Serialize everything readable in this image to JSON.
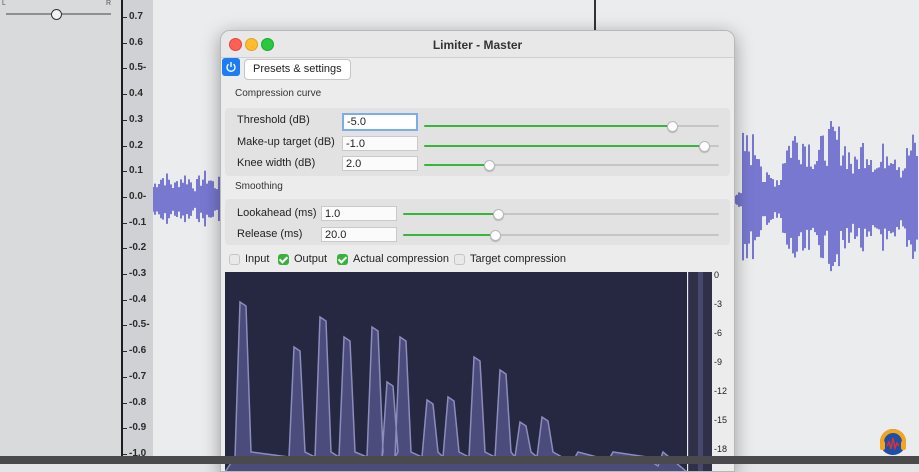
{
  "audacity": {
    "slider_left_label": "L",
    "slider_right_label": "R",
    "ruler_ticks": [
      "0.7",
      "0.6",
      "0.5-",
      "0.4",
      "0.3",
      "0.2",
      "0.1",
      "0.0-",
      "-0.1",
      "-0.2",
      "-0.3",
      "-0.4",
      "-0.5-",
      "-0.6",
      "-0.7",
      "-0.8",
      "-0.9",
      "-1.0"
    ],
    "waveform_color": "#5b5bc8"
  },
  "window": {
    "title": "Limiter - Master",
    "presets_label": "Presets & settings"
  },
  "compression_curve": {
    "title": "Compression curve",
    "params": [
      {
        "label": "Threshold (dB)",
        "value": "-5.0",
        "level": 0.84
      },
      {
        "label": "Make-up target (dB)",
        "value": "-1.0",
        "level": 0.95
      },
      {
        "label": "Knee width (dB)",
        "value": "2.0",
        "level": 0.22
      }
    ]
  },
  "smoothing": {
    "title": "Smoothing",
    "params": [
      {
        "label": "Lookahead (ms)",
        "value": "1.0",
        "level": 0.3
      },
      {
        "label": "Release (ms)",
        "value": "20.0",
        "level": 0.29
      }
    ]
  },
  "display_options": [
    {
      "label": "Input",
      "checked": false
    },
    {
      "label": "Output",
      "checked": true
    },
    {
      "label": "Actual compression",
      "checked": true
    },
    {
      "label": "Target compression",
      "checked": false
    }
  ],
  "db_scale": [
    "0",
    "-3",
    "-6",
    "-9",
    "-12",
    "-15",
    "-18"
  ],
  "colors": {
    "accent": "#38b63b",
    "power": "#1d7cf2",
    "graph_bg": "#262741",
    "graph_wave": "#8c8dbd"
  }
}
